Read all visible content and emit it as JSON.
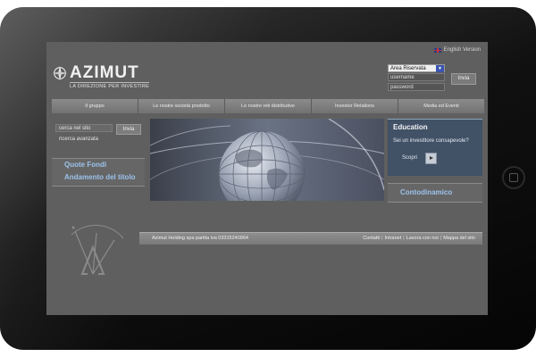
{
  "header": {
    "language_link": "English Version",
    "logo": {
      "name": "AZIMUT",
      "tagline": "LA DIREZIONE PER INVESTIRE"
    }
  },
  "login": {
    "area_select": "Area Riservata",
    "username_placeholder": "username",
    "password_placeholder": "password",
    "submit_label": "Invia"
  },
  "nav": {
    "items": [
      "Il gruppo",
      "Le nostre società prodotto",
      "Le nostre reti distributive",
      "Investor Relations",
      "Media ed Eventi"
    ]
  },
  "search": {
    "placeholder": "cerca nel sito",
    "submit_label": "Invia",
    "advanced_link": "ricerca avanzata"
  },
  "side_links": {
    "quote": "Quote Fondi",
    "stock": "Andamento del titolo"
  },
  "education": {
    "title": "Education",
    "question": "Sei un investitore consapevole?",
    "cta": "Scopri"
  },
  "contodinamico": {
    "label": "Contodinamico"
  },
  "footer": {
    "company": "Azimut Holding spa partita iva 03315240964",
    "links": [
      "Contatti",
      "Intranet",
      "Lavora con noi",
      "Mappa del sito"
    ]
  },
  "colors": {
    "background": "#5f5f5f",
    "link_blue": "#9cc3ec",
    "education_bg": "#415166"
  }
}
